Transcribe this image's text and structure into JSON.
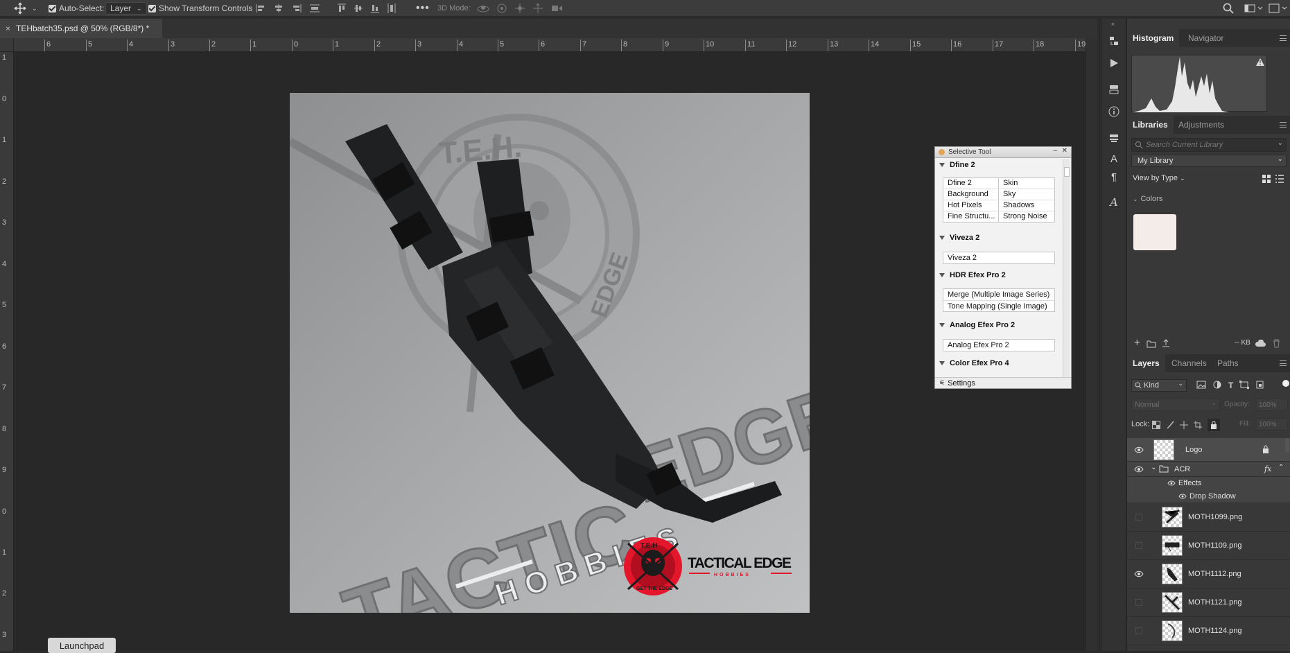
{
  "options_bar": {
    "auto_select_label": "Auto-Select:",
    "auto_select_value": "Layer",
    "show_transform_label": "Show Transform Controls",
    "mode_3d_label": "3D Mode:"
  },
  "document": {
    "tab_title": "TEHbatch35.psd @ 50% (RGB/8*) *"
  },
  "rulers": {
    "horizontal": [
      "6",
      "5",
      "4",
      "3",
      "2",
      "1",
      "0",
      "1",
      "2",
      "3",
      "4",
      "5",
      "6",
      "7",
      "8",
      "9",
      "10",
      "11",
      "12",
      "13",
      "14",
      "15",
      "16",
      "17",
      "18",
      "19"
    ],
    "vertical": [
      "1",
      "0",
      "1",
      "2",
      "3",
      "4",
      "5",
      "6",
      "7",
      "8",
      "9",
      "0",
      "1",
      "2",
      "3"
    ]
  },
  "artwork": {
    "brand_main": "TACTICAL EDGE",
    "brand_sub": "HOBBIES",
    "bg_text_1": "TACTIC",
    "bg_text_2": "EDGE",
    "bg_text_3": "H O B B I E S",
    "seal_top": "T.E.H.",
    "seal_side": "EDGE",
    "logo_badge_top": "T.E.H",
    "logo_badge_bottom": "GET THE EDGE",
    "brand_color": "#e3162b"
  },
  "launchpad": {
    "label": "Launchpad"
  },
  "plugin": {
    "title": "Selective Tool",
    "sections": [
      {
        "name": "Dfine 2",
        "cells": [
          "Dfine 2",
          "Skin",
          "Background",
          "Sky",
          "Hot Pixels",
          "Shadows",
          "Fine Structu...",
          "Strong Noise"
        ]
      },
      {
        "name": "Viveza 2",
        "cells": [
          "Viveza 2"
        ]
      },
      {
        "name": "HDR Efex Pro 2",
        "cells": [
          "Merge (Multiple Image Series)",
          "Tone Mapping (Single Image)"
        ]
      },
      {
        "name": "Analog Efex Pro 2",
        "cells": [
          "Analog Efex Pro 2"
        ]
      },
      {
        "name": "Color Efex Pro 4",
        "cells": []
      }
    ],
    "settings_label": "Settings"
  },
  "histogram_panel": {
    "tabs": [
      "Histogram",
      "Navigator"
    ],
    "warning_icon": "warning-icon"
  },
  "libraries_panel": {
    "tabs": [
      "Libraries",
      "Adjustments"
    ],
    "search_placeholder": "Search Current Library",
    "library_select": "My Library",
    "view_by": "View by Type",
    "colors_label": "Colors",
    "swatch_color": "#f3ece8",
    "size_label": "-- KB"
  },
  "layers_panel": {
    "tabs": [
      "Layers",
      "Channels",
      "Paths"
    ],
    "filter_kind": "Kind",
    "blend_mode": "Normal",
    "opacity_label": "Opacity:",
    "opacity_value": "100%",
    "lock_label": "Lock:",
    "fill_label": "Fill:",
    "fill_value": "100%",
    "layers": [
      {
        "name": "Logo",
        "visible": true,
        "locked": true,
        "type": "layer"
      },
      {
        "name": "ACR",
        "visible": true,
        "type": "group",
        "fx": "fx"
      },
      {
        "name": "Effects",
        "type": "effects"
      },
      {
        "name": "Drop Shadow",
        "type": "effect"
      },
      {
        "name": "MOTH1099.png",
        "visible": false,
        "type": "layer"
      },
      {
        "name": "MOTH1109.png",
        "visible": false,
        "type": "layer"
      },
      {
        "name": "MOTH1112.png",
        "visible": true,
        "type": "layer"
      },
      {
        "name": "MOTH1121.png",
        "visible": false,
        "type": "layer"
      },
      {
        "name": "MOTH1124.png",
        "visible": false,
        "type": "layer"
      }
    ]
  }
}
